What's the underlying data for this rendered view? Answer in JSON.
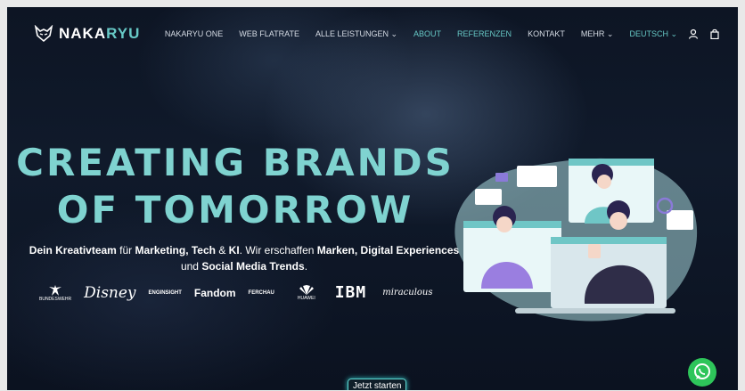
{
  "brand": {
    "prefix": "NAKA",
    "accent": "RYU"
  },
  "nav": {
    "items": [
      {
        "label": "NAKARYU ONE",
        "active": false
      },
      {
        "label": "WEB FLATRATE",
        "active": false
      },
      {
        "label": "ALLE LEISTUNGEN ⌄",
        "active": false
      },
      {
        "label": "ABOUT",
        "active": true
      },
      {
        "label": "REFERENZEN",
        "active": true
      },
      {
        "label": "KONTAKT",
        "active": false
      },
      {
        "label": "MEHR ⌄",
        "active": false
      },
      {
        "label": "DEUTSCH ⌄",
        "active": true
      }
    ],
    "icons": [
      "user-icon",
      "bag-icon"
    ]
  },
  "hero": {
    "line1": "CREATING BRANDS",
    "line2": "OF TOMORROW",
    "subtitle": {
      "p1": "Dein Kreativteam",
      "p2": " für ",
      "p3": "Marketing, Tech",
      "p4": " & ",
      "p5": "KI",
      "p6": ". Wir erschaffen ",
      "p7": "Marken, Digital Experiences",
      "p8": "und ",
      "p9": "Social Media Trends",
      "p10": "."
    },
    "cta": "Jetzt starten"
  },
  "client_logos": [
    "BUNDESWEHR",
    "Disney",
    "ENGINSIGHT",
    "Fandom",
    "FERCHAU",
    "HUAWEI",
    "IBM",
    "miraculous"
  ],
  "colors": {
    "accent": "#67c9c6",
    "whatsapp": "#2ec55a"
  }
}
